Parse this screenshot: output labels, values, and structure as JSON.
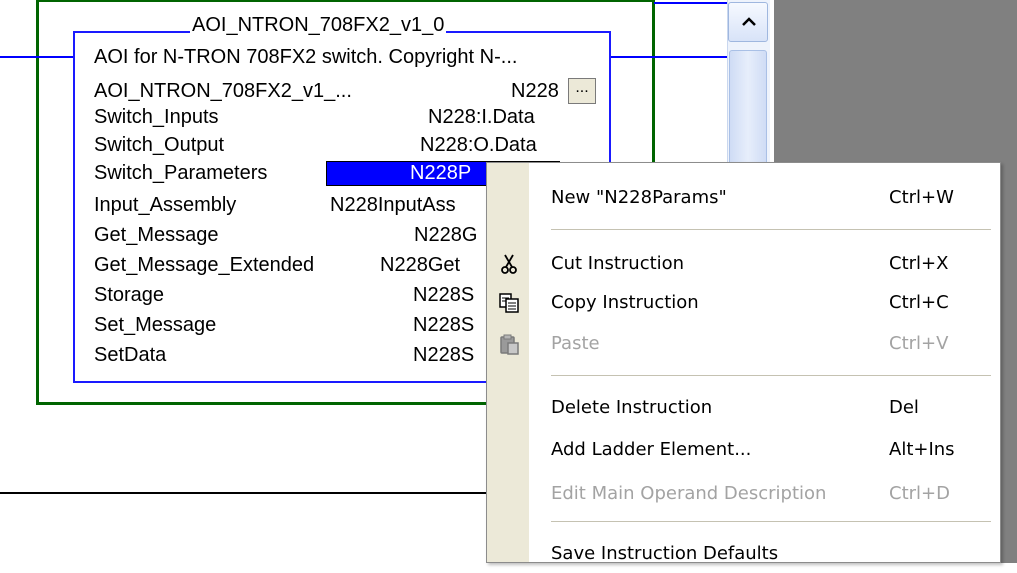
{
  "aoi": {
    "title": "AOI_NTRON_708FX2_v1_0",
    "description": "AOI for N-TRON 708FX2 switch. Copyright N-...",
    "rows": [
      {
        "label": "AOI_NTRON_708FX2_v1_...",
        "value": "N228"
      },
      {
        "label": "Switch_Inputs",
        "value": "N228:I.Data"
      },
      {
        "label": "Switch_Output",
        "value": "N228:O.Data"
      },
      {
        "label": "Switch_Parameters",
        "value": "N228P"
      },
      {
        "label": "Input_Assembly",
        "value": "N228InputAss"
      },
      {
        "label": "Get_Message",
        "value": "N228G"
      },
      {
        "label": "Get_Message_Extended",
        "value": "N228Get"
      },
      {
        "label": "Storage",
        "value": "N228S"
      },
      {
        "label": "Set_Message",
        "value": "N228S"
      },
      {
        "label": "SetData",
        "value": "N228S"
      }
    ],
    "ellipsis_label": "..."
  },
  "context_menu": {
    "items": [
      {
        "label": "New \"N228Params\"",
        "shortcut": "Ctrl+W",
        "enabled": true
      },
      {
        "label": "Cut Instruction",
        "shortcut": "Ctrl+X",
        "enabled": true,
        "icon": "scissors-icon"
      },
      {
        "label": "Copy Instruction",
        "shortcut": "Ctrl+C",
        "enabled": true,
        "icon": "copy-icon"
      },
      {
        "label": "Paste",
        "shortcut": "Ctrl+V",
        "enabled": false,
        "icon": "paste-icon"
      },
      {
        "label": "Delete Instruction",
        "shortcut": "Del",
        "enabled": true
      },
      {
        "label": "Add Ladder Element...",
        "shortcut": "Alt+Ins",
        "enabled": true
      },
      {
        "label": "Edit Main Operand Description",
        "shortcut": "Ctrl+D",
        "enabled": false
      },
      {
        "label": "Save Instruction Defaults",
        "shortcut": "",
        "enabled": true
      }
    ]
  },
  "colors": {
    "highlight": "#0000ff",
    "rail": "#006400",
    "wire": "#0000ff",
    "disabled_text": "#a3a3a3"
  }
}
